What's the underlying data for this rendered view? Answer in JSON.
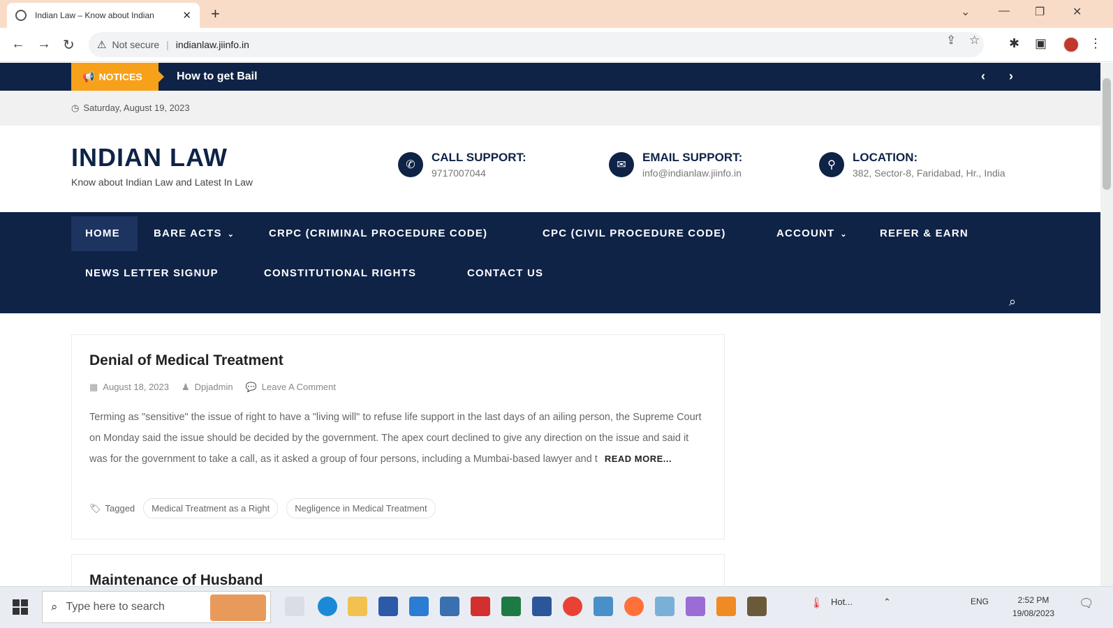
{
  "browser": {
    "tab_title": "Indian Law – Know about Indian",
    "tab_close": "✕",
    "new_tab": "+",
    "security_label": "Not secure",
    "url": "indianlaw.jiinfo.in"
  },
  "notices": {
    "label": "NOTICES",
    "text": "How to get Bail"
  },
  "date": "Saturday, August 19, 2023",
  "site": {
    "title": "INDIAN LAW",
    "tagline": "Know about Indian Law and Latest In Law"
  },
  "contacts": [
    {
      "label": "CALL SUPPORT:",
      "value": "9717007044"
    },
    {
      "label": "EMAIL SUPPORT:",
      "value": "info@indianlaw.jiinfo.in"
    },
    {
      "label": "LOCATION:",
      "value": "382, Sector-8, Faridabad, Hr., India"
    }
  ],
  "nav": {
    "row1": [
      "HOME",
      "BARE ACTS",
      "CRPC (CRIMINAL PROCEDURE CODE)",
      "CPC (CIVIL PROCEDURE CODE)",
      "ACCOUNT",
      "REFER & EARN"
    ],
    "row2": [
      "NEWS LETTER SIGNUP",
      "CONSTITUTIONAL RIGHTS",
      "CONTACT US"
    ]
  },
  "posts": [
    {
      "title": "Denial of Medical Treatment",
      "date": "August 18, 2023",
      "author": "Dpjadmin",
      "comments": "Leave A Comment",
      "excerpt": "Terming as \"sensitive\" the issue of right to have a \"living will\" to refuse life support in the last days of an ailing person, the Supreme Court on Monday said the issue should be decided by the government. The apex court declined to give any direction on the issue and said it was for the government to take a call, as it asked a group of four persons, including a Mumbai-based lawyer and t",
      "read_more": "READ MORE...",
      "tagged_label": "Tagged",
      "tags": [
        "Medical Treatment as a Right",
        "Negligence in Medical Treatment"
      ]
    },
    {
      "title": "Maintenance of Husband"
    }
  ],
  "taskbar": {
    "search_placeholder": "Type here to search",
    "weather": "Hot...",
    "lang": "ENG",
    "time": "2:52 PM",
    "date": "19/08/2023"
  }
}
